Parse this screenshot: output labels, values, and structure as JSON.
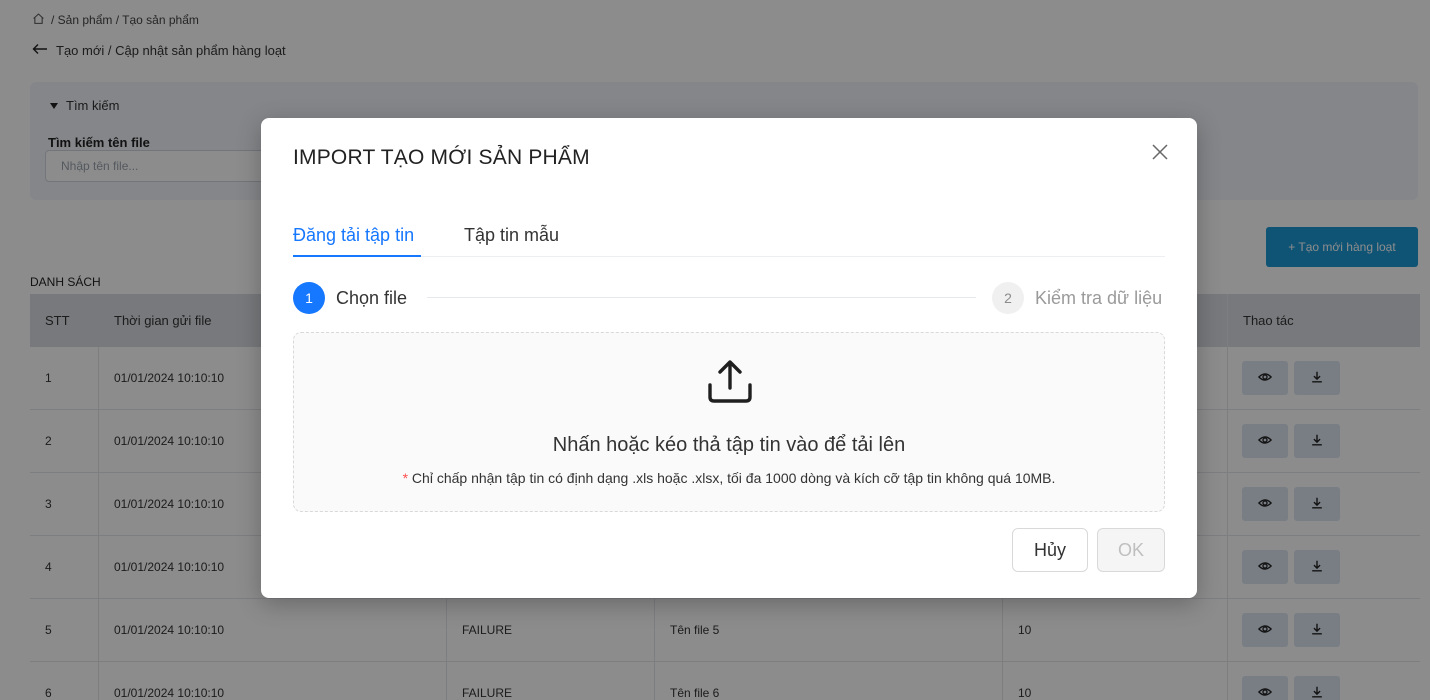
{
  "breadcrumb": {
    "path": "/ Sản phẩm / Tạo sản phẩm"
  },
  "page": {
    "subtitle": "Tạo mới / Cập nhật sản phẩm hàng loạt"
  },
  "search": {
    "toggle_label": "Tìm kiếm",
    "field_label": "Tìm kiếm tên file",
    "placeholder": "Nhập tên file..."
  },
  "create_button": "+ Tạo mới hàng loạt",
  "list": {
    "title": "DANH SÁCH",
    "columns": {
      "stt": "STT",
      "time": "Thời gian gửi file",
      "status": "",
      "name": "",
      "date": "",
      "count": "",
      "actions": "Thao tác"
    },
    "rows": [
      {
        "stt": "1",
        "time": "01/01/2024 10:10:10",
        "status": "",
        "name": "",
        "count": ""
      },
      {
        "stt": "2",
        "time": "01/01/2024 10:10:10",
        "status": "",
        "name": "",
        "count": ""
      },
      {
        "stt": "3",
        "time": "01/01/2024 10:10:10",
        "status": "",
        "name": "",
        "count": ""
      },
      {
        "stt": "4",
        "time": "01/01/2024 10:10:10",
        "status": "",
        "name": "",
        "count": ""
      },
      {
        "stt": "5",
        "time": "01/01/2024 10:10:10",
        "status": "FAILURE",
        "name": "Tên file 5",
        "count": "10"
      },
      {
        "stt": "6",
        "time": "01/01/2024 10:10:10",
        "status": "FAILURE",
        "name": "Tên file 6",
        "count": "10"
      }
    ]
  },
  "modal": {
    "title": "IMPORT TẠO MỚI SẢN PHẨM",
    "tabs": {
      "upload": "Đăng tải tập tin",
      "template": "Tập tin mẫu"
    },
    "steps": {
      "s1_num": "1",
      "s1_label": "Chọn file",
      "s2_num": "2",
      "s2_label": "Kiểm tra dữ liệu"
    },
    "dropzone": {
      "text": "Nhấn hoặc kéo thả tập tin vào để tải lên",
      "required_mark": "*",
      "hint": " Chỉ chấp nhận tập tin có định dạng .xls hoặc .xlsx, tối đa 1000 dòng và kích cỡ tập tin không quá 10MB."
    },
    "cancel_label": "Hủy",
    "ok_label": "OK"
  },
  "colors": {
    "primary": "#1677ff",
    "create_button": "#1e9ad6",
    "header_bg": "#d9dde2"
  },
  "icons": [
    "home-icon",
    "arrow-left-icon",
    "caret-down-icon",
    "eye-icon",
    "download-icon",
    "close-icon",
    "upload-icon"
  ]
}
